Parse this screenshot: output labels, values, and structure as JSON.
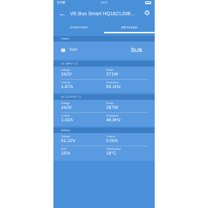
{
  "status_bar": {
    "carrier": "空中網",
    "time": "19:07"
  },
  "app_bar": {
    "title": "VE.Bus Smart HQ1821JSB...",
    "back_icon": "arrow-back-icon",
    "settings_icon": "gear-icon"
  },
  "tabs": [
    {
      "label": "OVERVIEW"
    },
    {
      "label": "DETAILED",
      "selected": true
    }
  ],
  "sections": {
    "status": {
      "header": "Status",
      "state_label": "State",
      "state_value": "Bulk"
    },
    "ac_input": {
      "header": "AC INPUT L1",
      "voltage_label": "Voltage",
      "voltage": "242V",
      "power_label": "Power",
      "power": "271W",
      "current_label": "Current",
      "current": "1.67A",
      "frequency_label": "Frequency",
      "frequency": "50.1Hz"
    },
    "ac_output": {
      "header": "AC OUTPUT L1",
      "voltage_label": "Voltage",
      "voltage": "242V",
      "power_label": "Power",
      "power": "267W",
      "current_label": "Current",
      "current": "1.42A",
      "frequency_label": "Frequency",
      "frequency": "49.9Hz"
    },
    "battery": {
      "header": "Battery",
      "voltage_label": "Voltage",
      "voltage": "51.10V",
      "current_label": "Current",
      "current": "0.00A",
      "soc_label": "SOC",
      "soc": "15%",
      "temperature_label": "Temperature",
      "temperature": "18°C"
    }
  },
  "colors": {
    "background": "#4a90d9",
    "section_header": "#3d7fc6",
    "section_body": "#5a9ae0",
    "text": "#ffffff"
  }
}
